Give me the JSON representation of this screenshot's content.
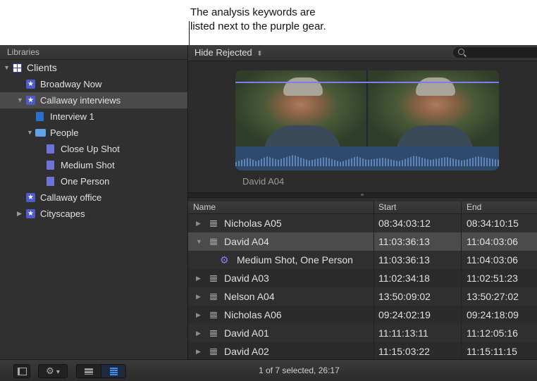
{
  "callout": {
    "line1": "The analysis keywords are",
    "line2": "listed next to the purple gear."
  },
  "sidebar": {
    "header": "Libraries",
    "items": [
      {
        "label": "Clients",
        "icon": "library-icon",
        "indent": 0,
        "expanded": true
      },
      {
        "label": "Broadway Now",
        "icon": "event-star-icon",
        "indent": 1
      },
      {
        "label": "Callaway interviews",
        "icon": "event-star-icon",
        "indent": 1,
        "expanded": true,
        "selected": true
      },
      {
        "label": "Interview 1",
        "icon": "project-icon",
        "indent": 2
      },
      {
        "label": "People",
        "icon": "folder-icon",
        "indent": 2,
        "expanded": true
      },
      {
        "label": "Close Up Shot",
        "icon": "keyword-collection-icon",
        "indent": 3
      },
      {
        "label": "Medium Shot",
        "icon": "keyword-collection-icon",
        "indent": 3
      },
      {
        "label": "One Person",
        "icon": "keyword-collection-icon",
        "indent": 3
      },
      {
        "label": "Callaway office",
        "icon": "event-star-icon",
        "indent": 1
      },
      {
        "label": "Cityscapes",
        "icon": "event-star-icon",
        "indent": 1,
        "expanded": false
      }
    ]
  },
  "toolbar": {
    "filter": "Hide Rejected",
    "filter_arrows": "⬍",
    "search_placeholder": ""
  },
  "preview": {
    "clip_name": "David A04"
  },
  "list": {
    "columns": {
      "name": "Name",
      "start": "Start",
      "end": "End"
    },
    "rows": [
      {
        "name": "Nicholas A05",
        "start": "08:34:03:12",
        "end": "08:34:10:15"
      },
      {
        "name": "David A04",
        "start": "11:03:36:13",
        "end": "11:04:03:06",
        "expanded": true,
        "selected": true
      },
      {
        "name": "Medium Shot, One Person",
        "start": "11:03:36:13",
        "end": "11:04:03:06",
        "keyword": true
      },
      {
        "name": "David A03",
        "start": "11:02:34:18",
        "end": "11:02:51:23"
      },
      {
        "name": "Nelson A04",
        "start": "13:50:09:02",
        "end": "13:50:27:02"
      },
      {
        "name": "Nicholas A06",
        "start": "09:24:02:19",
        "end": "09:24:18:09"
      },
      {
        "name": "David A01",
        "start": "11:11:13:11",
        "end": "11:12:05:16"
      },
      {
        "name": "David A02",
        "start": "11:15:03:22",
        "end": "11:15:11:15"
      }
    ]
  },
  "status": {
    "text": "1 of 7 selected, 26:17"
  },
  "icons": {
    "triangle_right": "▶",
    "triangle_down": "▼",
    "gear": "⚙",
    "star": "★",
    "chevron_down": "▾"
  },
  "colors": {
    "keyword_gear": "#8b7ef5",
    "keyword_line": "#7e7cf0",
    "active_blue": "#3d8cf0"
  }
}
